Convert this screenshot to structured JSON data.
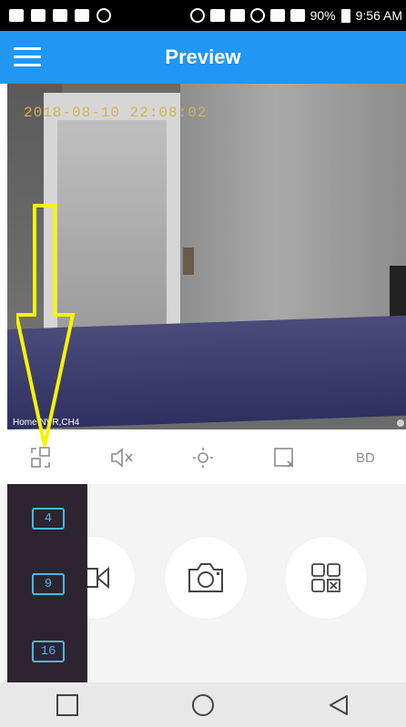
{
  "status_bar": {
    "battery": "90%",
    "time": "9:56 AM"
  },
  "app_bar": {
    "title": "Preview",
    "menu_icon": "hamburger-menu-icon",
    "color": "#2196f3"
  },
  "video": {
    "timestamp": "2018-08-10  22:08:02",
    "camera_label": "Home NVR,CH4"
  },
  "controls": {
    "items": [
      {
        "icon": "split-screen-icon"
      },
      {
        "icon": "mute-icon"
      },
      {
        "icon": "ptz-control-icon"
      },
      {
        "icon": "close-window-icon"
      },
      {
        "label": "BD"
      }
    ]
  },
  "actions": [
    {
      "icon": "record-video-icon"
    },
    {
      "icon": "snapshot-camera-icon"
    },
    {
      "icon": "multi-view-icon"
    }
  ],
  "split_panel": {
    "options": [
      "4",
      "9",
      "16"
    ],
    "accent": "#4db6e8"
  },
  "annotation": {
    "arrow_color": "#f5f500"
  },
  "nav_bar": {
    "buttons": [
      "recent-apps-icon",
      "home-icon",
      "back-icon"
    ]
  }
}
